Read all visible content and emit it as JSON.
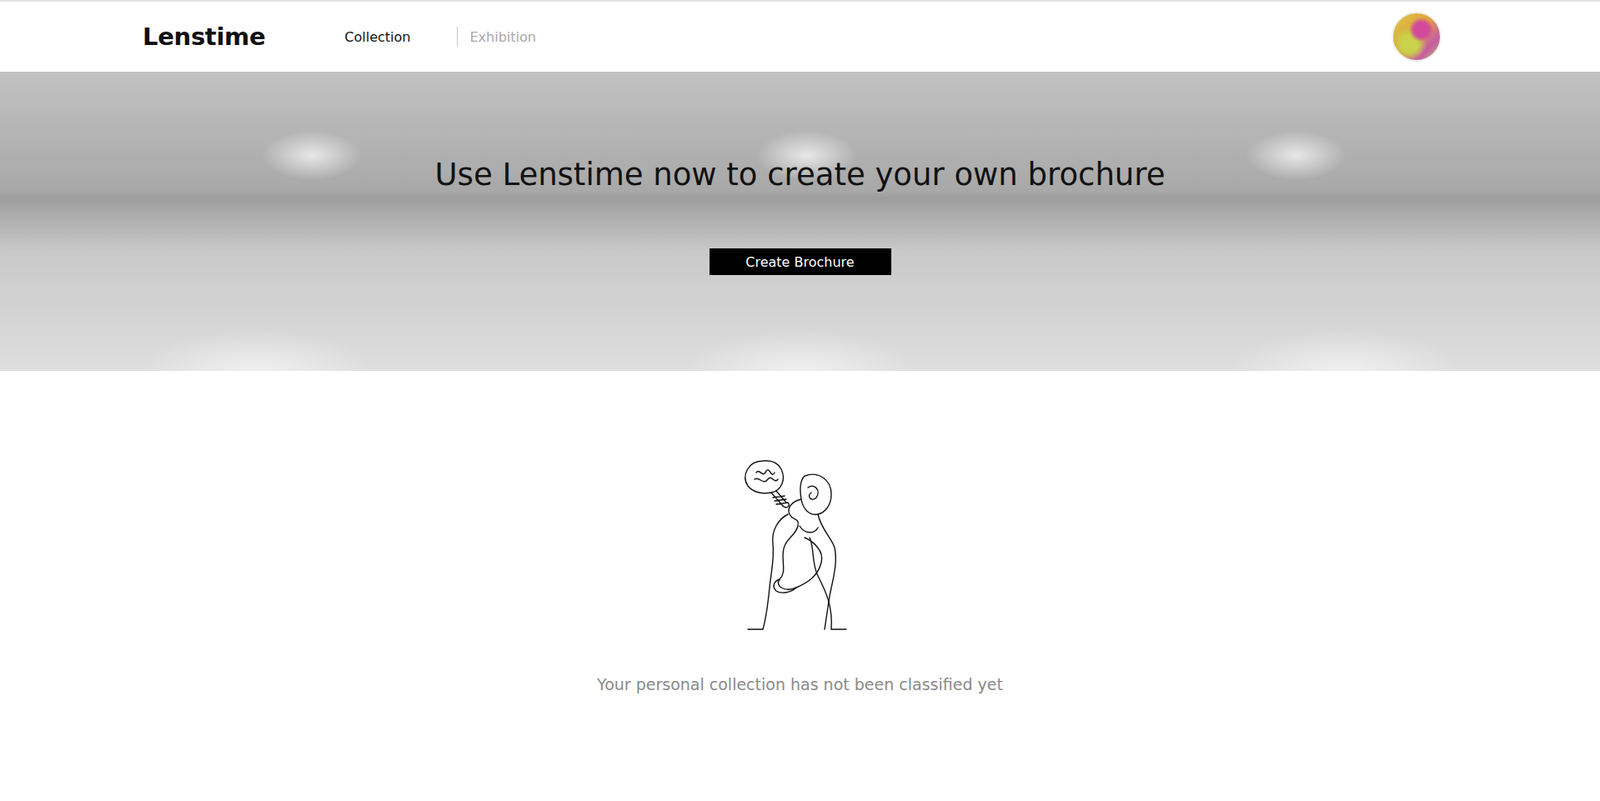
{
  "nav": {
    "logo": "Lenstime",
    "links": [
      {
        "label": "Collection",
        "selected": true
      },
      {
        "label": "Exhibition",
        "selected": false
      }
    ]
  },
  "hero": {
    "title": "Use Lenstime now to create your own brochure",
    "button": "Create Brochure"
  },
  "empty_state": {
    "message": "Your personal collection has not been classified yet"
  }
}
